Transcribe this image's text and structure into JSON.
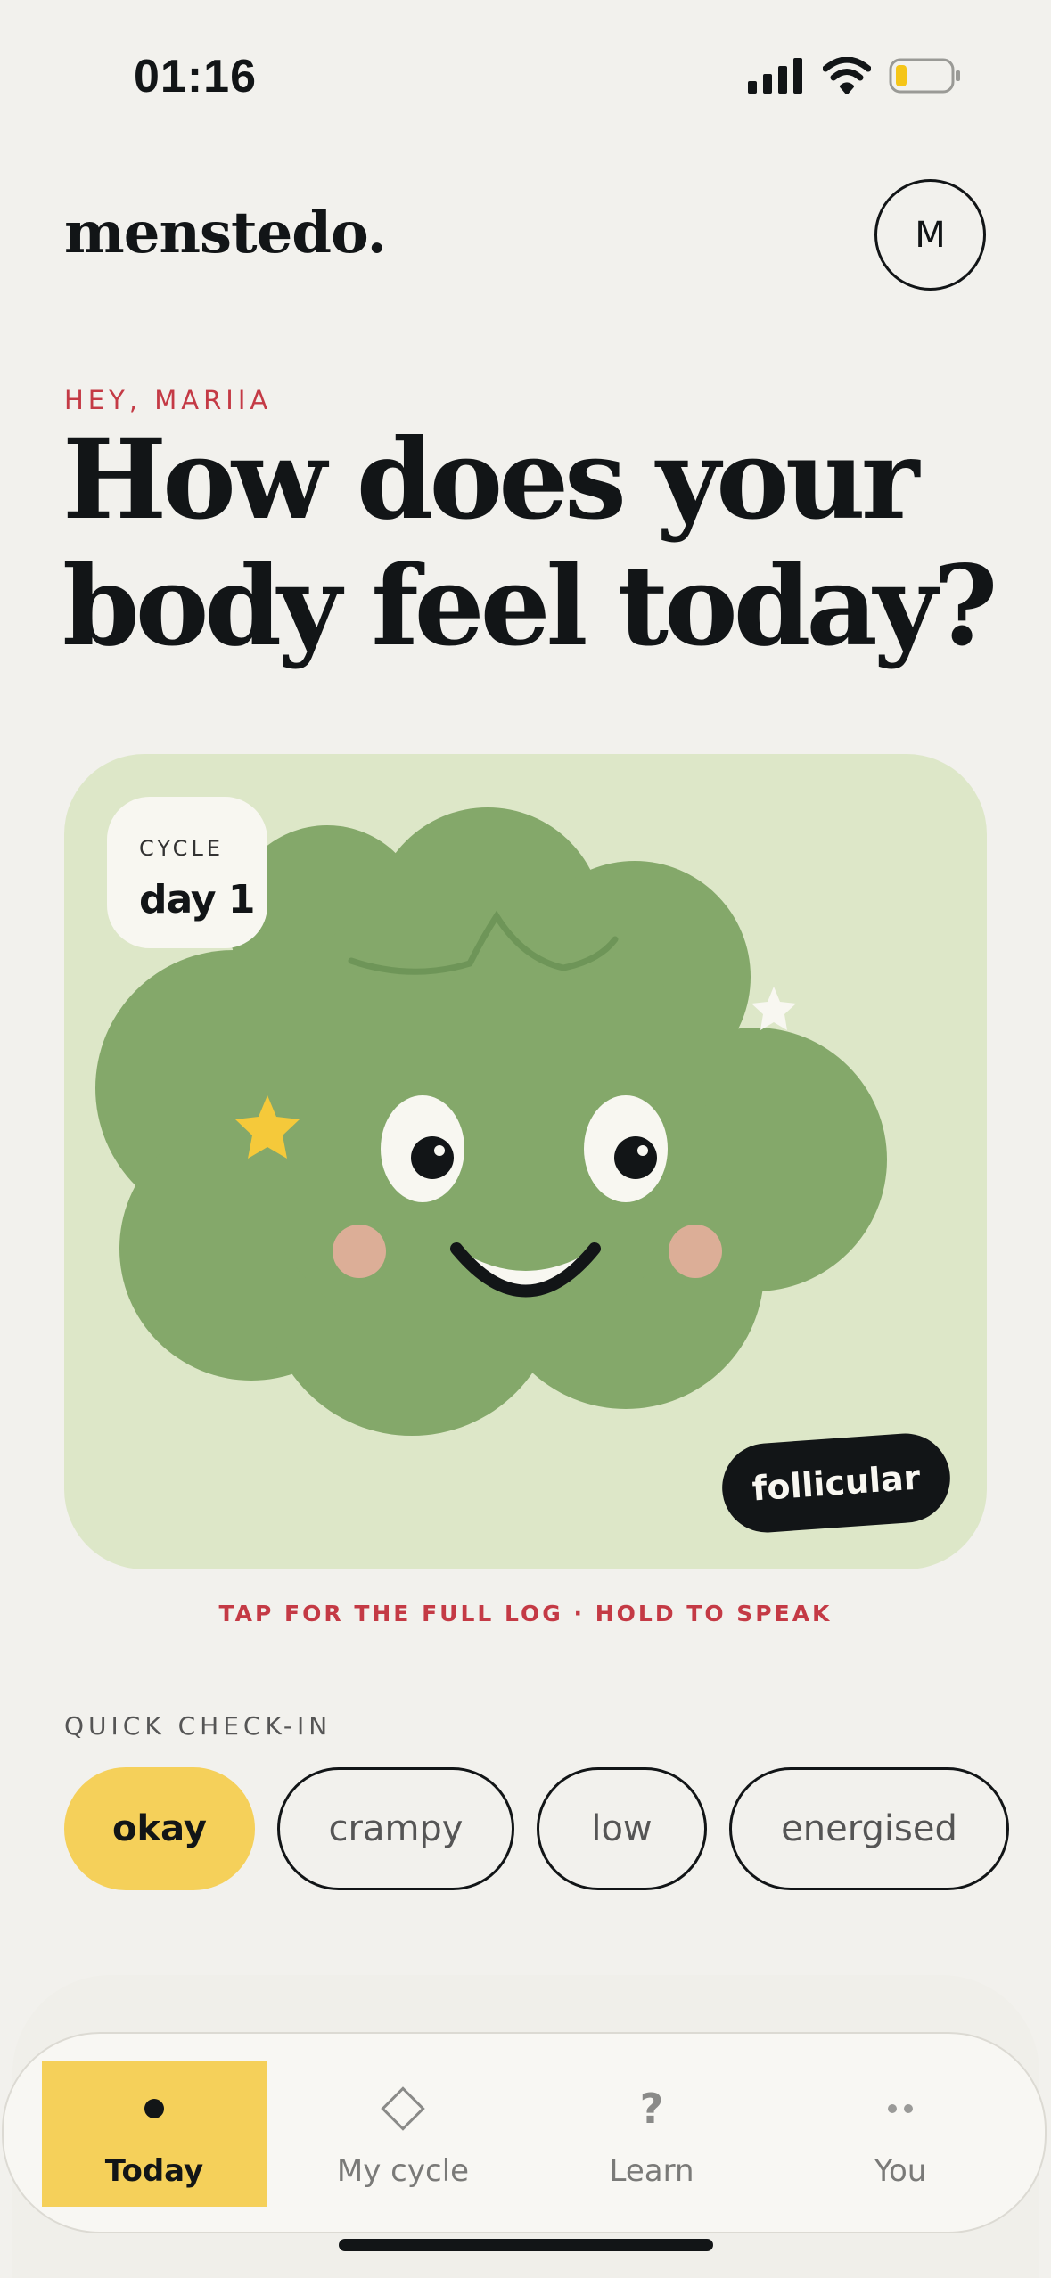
{
  "status": {
    "time": "01:16"
  },
  "header": {
    "brand": "menstedo.",
    "avatar_initial": "M"
  },
  "greeting": "HEY, MARIIA",
  "headline": {
    "line1": "How does your",
    "line2": "body feel today?"
  },
  "hero": {
    "cycle_label": "CYCLE",
    "cycle_day": "day 1",
    "phase": "follicular",
    "colors": {
      "card": "#dde7c8",
      "blob": "#84a86a",
      "cheeks": "#dcae97",
      "accent": "#f5d05a"
    }
  },
  "hint": "TAP FOR THE FULL LOG · HOLD TO SPEAK",
  "quick_checkin": {
    "label": "QUICK CHECK-IN",
    "options": [
      "okay",
      "crampy",
      "low",
      "energised"
    ],
    "selected": "okay"
  },
  "tabbar": {
    "items": [
      {
        "label": "Today",
        "icon": "dot-icon"
      },
      {
        "label": "My cycle",
        "icon": "diamond-icon"
      },
      {
        "label": "Learn",
        "icon": "question-icon"
      },
      {
        "label": "You",
        "icon": "two-dots-icon"
      }
    ],
    "active": "Today"
  }
}
